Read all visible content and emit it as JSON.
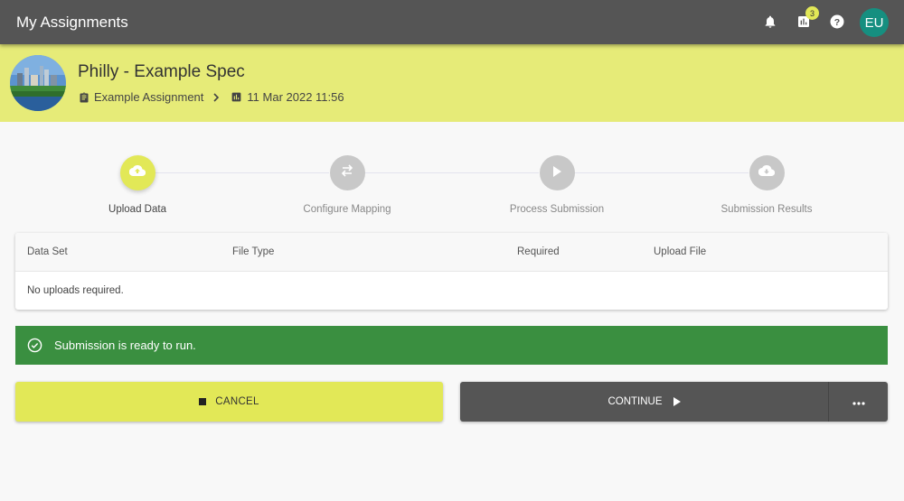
{
  "topbar": {
    "title": "My Assignments",
    "icons": [
      "bell-icon",
      "chart-icon",
      "help-icon"
    ],
    "notification_badge": "3",
    "avatar_initials": "EU",
    "avatar_color": "#168f80"
  },
  "header": {
    "title": "Philly - Example Spec",
    "breadcrumb": {
      "assignment": "Example Assignment",
      "date": "11 Mar 2022 11:56"
    },
    "background": "#e6eb78"
  },
  "stepper": {
    "steps": [
      {
        "label": "Upload Data",
        "icon": "cloud-upload-icon",
        "active": true
      },
      {
        "label": "Configure Mapping",
        "icon": "swap-arrows-icon",
        "active": false
      },
      {
        "label": "Process Submission",
        "icon": "play-icon",
        "active": false
      },
      {
        "label": "Submission Results",
        "icon": "cloud-download-icon",
        "active": false
      }
    ],
    "accent": "#e2e857"
  },
  "table": {
    "columns": [
      "Data Set",
      "File Type",
      "Required",
      "Upload File"
    ],
    "empty_message": "No uploads required."
  },
  "alert": {
    "message": "Submission is ready to run.",
    "color": "#3a8f40"
  },
  "actions": {
    "cancel_label": "CANCEL",
    "continue_label": "CONTINUE",
    "more_label": "more options"
  }
}
